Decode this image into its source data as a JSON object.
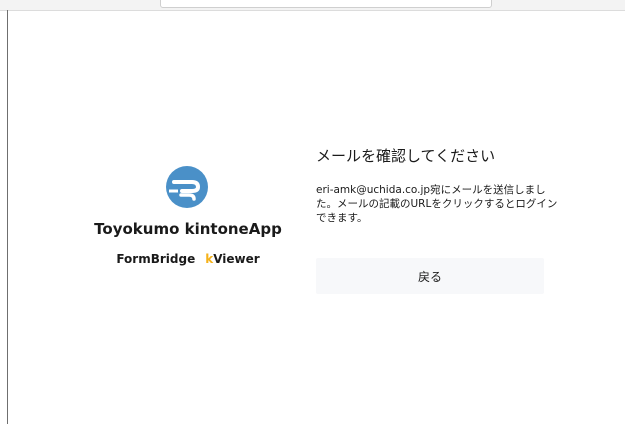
{
  "brand": {
    "name": "Toyokumo kintoneApp",
    "product_1": "FormBridge",
    "product_2_accent": "k",
    "product_2_rest": "Viewer",
    "logo_icon": "toyokumo-cloud-logo-icon",
    "logo_color": "#4a90c8",
    "accent_color": "#f5b21a"
  },
  "confirm": {
    "title": "メールを確認してください",
    "message": "eri-amk@uchida.co.jp宛にメールを送信しました。メールの記載のURLをクリックするとログインできます。",
    "back_label": "戻る"
  }
}
